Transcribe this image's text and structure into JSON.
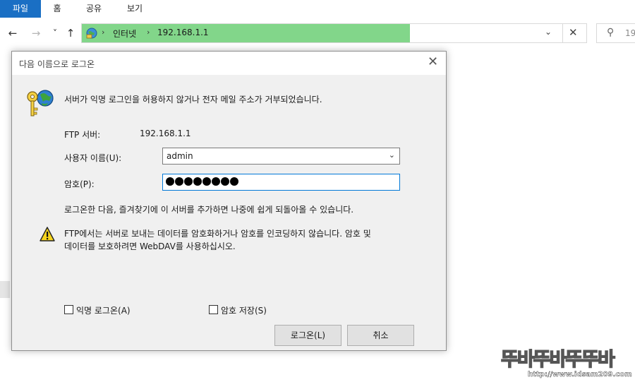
{
  "ribbon": {
    "tabs": [
      "파일",
      "홈",
      "공유",
      "보기"
    ]
  },
  "nav": {
    "back_glyph": "←",
    "forward_glyph": "→",
    "recent_glyph": "˅",
    "up_glyph": "↑"
  },
  "address": {
    "crumbs": [
      "인터넷",
      "192.168.1.1"
    ],
    "separator": "›",
    "dropdown_glyph": "⌄",
    "close_glyph": "✕",
    "fill_color": "#82d68a"
  },
  "search": {
    "glyph": "⚲",
    "placeholder": "19"
  },
  "dialog": {
    "title": "다음 이름으로 로그온",
    "close_glyph": "✕",
    "message": "서버가 익명 로그인을 허용하지 않거나 전자 메일 주소가 거부되었습니다.",
    "server_label": "FTP 서버:",
    "server_value": "192.168.1.1",
    "username_label": "사용자 이름(U):",
    "username_value": "admin",
    "password_label": "암호(P):",
    "password_length": 8,
    "hint": "로그온한 다음, 즐겨찾기에 이 서버를 추가하면 나중에 쉽게 되돌아올 수 있습니다.",
    "warning_line1": "FTP에서는 서버로 보내는 데이터를 암호화하거나 암호를 인코딩하지 않습니다. 암호 및",
    "warning_line2": "데이터를 보호하려면 WebDAV를 사용하십시오.",
    "anonymous_label": "익명 로그온(A)",
    "anonymous_checked": false,
    "save_password_label": "암호 저장(S)",
    "save_password_checked": false,
    "logon_button": "로그온(L)",
    "cancel_button": "취소",
    "accent_color": "#0078d7"
  },
  "watermark": {
    "text": "뚜바뚜바뚜뚜바",
    "url": "http://www.idsam209.com"
  }
}
